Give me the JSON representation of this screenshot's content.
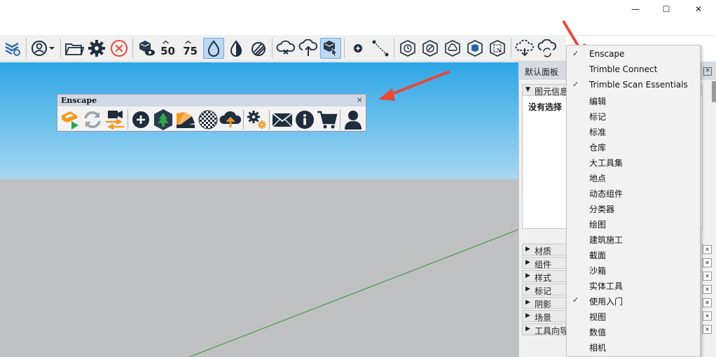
{
  "window": {
    "minimize": "—",
    "maximize": "☐",
    "close": "✕"
  },
  "toolbar": {
    "badge_50": "50",
    "badge_75": "75"
  },
  "enscape_toolbar": {
    "title": "Enscape",
    "close": "×"
  },
  "panel": {
    "title": "默认面板",
    "close": "×",
    "element_info": {
      "header": "图元信息",
      "body": "没有选择"
    },
    "sections": [
      "材质",
      "组件",
      "样式",
      "标记",
      "阴影",
      "场景",
      "工具向导"
    ]
  },
  "menu": {
    "items": [
      {
        "label": "Enscape",
        "checked": true
      },
      {
        "label": "Trimble Connect",
        "checked": false
      },
      {
        "label": "Trimble Scan Essentials",
        "checked": true
      },
      {
        "label": "编辑",
        "checked": false
      },
      {
        "label": "标记",
        "checked": false
      },
      {
        "label": "标准",
        "checked": false
      },
      {
        "label": "仓库",
        "checked": false
      },
      {
        "label": "大工具集",
        "checked": false
      },
      {
        "label": "地点",
        "checked": false
      },
      {
        "label": "动态组件",
        "checked": false
      },
      {
        "label": "分类器",
        "checked": false
      },
      {
        "label": "绘图",
        "checked": false
      },
      {
        "label": "建筑施工",
        "checked": false
      },
      {
        "label": "截面",
        "checked": false
      },
      {
        "label": "沙箱",
        "checked": false
      },
      {
        "label": "实体工具",
        "checked": false
      },
      {
        "label": "使用入门",
        "checked": true
      },
      {
        "label": "视图",
        "checked": false
      },
      {
        "label": "数值",
        "checked": false
      },
      {
        "label": "相机",
        "checked": false
      }
    ],
    "check_glyph": "✓"
  },
  "colors": {
    "accent_red": "#e8483a",
    "enscape_orange": "#f29a1f",
    "icon_dark": "#1f2d3d"
  }
}
